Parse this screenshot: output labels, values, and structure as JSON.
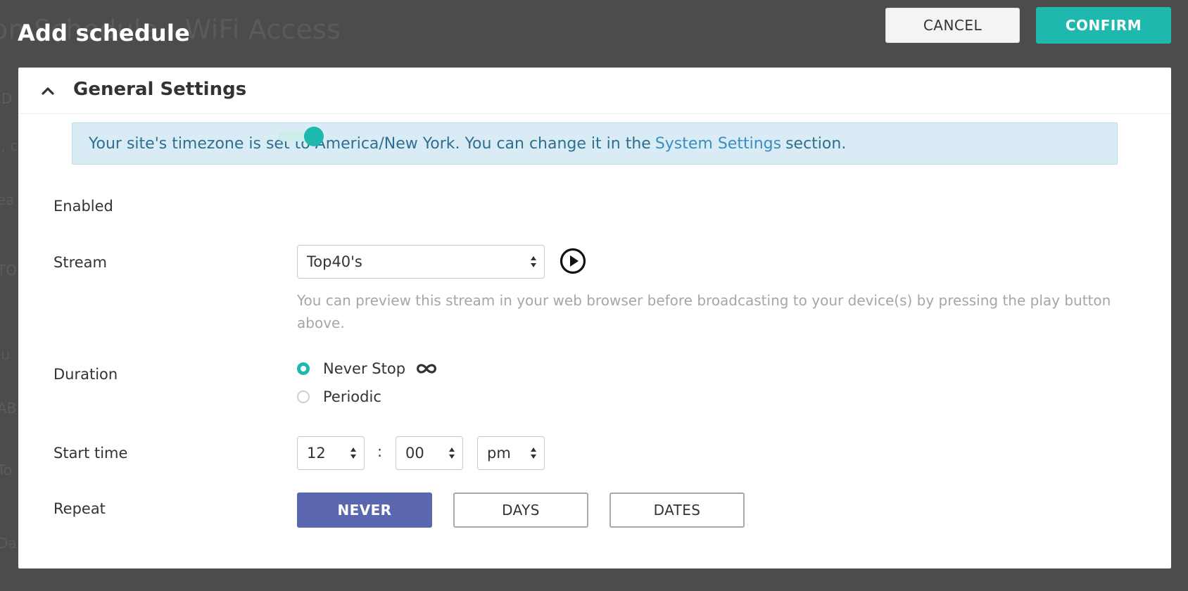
{
  "background": {
    "title": "on Schedule - WiFi Access",
    "fragments": [
      "ID",
      "i, c",
      "ea",
      "TO",
      "lu",
      "AB",
      "To",
      "Da"
    ]
  },
  "overlay": {
    "title": "Add schedule",
    "cancel_label": "CANCEL",
    "confirm_label": "CONFIRM"
  },
  "section": {
    "title": "General Settings",
    "chevron_icon": "chevron-up-icon"
  },
  "info": {
    "text_before": "Your site's timezone is set to America/New York. You can change it in the",
    "link_text": "System Settings",
    "text_after": "section."
  },
  "fields": {
    "enabled": {
      "label": "Enabled",
      "value": true
    },
    "stream": {
      "label": "Stream",
      "selected": "Top40's",
      "play_icon": "play-circle-icon",
      "help_text": "You can preview this stream in your web browser before broadcasting to your device(s) by pressing the play button above."
    },
    "duration": {
      "label": "Duration",
      "options": [
        {
          "label": "Never Stop",
          "checked": true
        },
        {
          "label": "Periodic",
          "checked": false
        }
      ],
      "infinity_icon": "infinity-icon"
    },
    "start_time": {
      "label": "Start time",
      "hour": "12",
      "separator": ":",
      "minute": "00",
      "ampm": "pm"
    },
    "repeat": {
      "label": "Repeat",
      "options": [
        {
          "label": "NEVER",
          "active": true
        },
        {
          "label": "DAYS",
          "active": false
        },
        {
          "label": "DATES",
          "active": false
        }
      ]
    }
  },
  "colors": {
    "accent": "#1fb8ad",
    "repeat_active": "#5a67af",
    "info_bg": "#d9ecf6",
    "overlay_bg": "#4c4c4c"
  }
}
